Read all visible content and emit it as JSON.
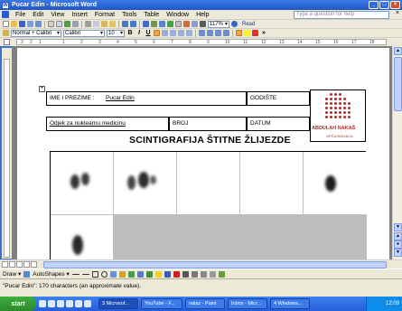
{
  "window": {
    "title": "Pucar Edin - Microsoft Word",
    "min_glyph": "_",
    "max_glyph": "□",
    "close_glyph": "×"
  },
  "menu": {
    "items": [
      "File",
      "Edit",
      "View",
      "Insert",
      "Format",
      "Tools",
      "Table",
      "Window",
      "Help"
    ],
    "help_placeholder": "Type a question for help",
    "close_glyph": "×"
  },
  "toolbar": {
    "zoom": "117%",
    "read_label": "Read",
    "style": "Normal + Calibri",
    "font": "Calibri",
    "font_size": "10",
    "bold": "B",
    "italic": "I",
    "underline": "U"
  },
  "ruler": {
    "ticks": [
      "3",
      "2",
      "1",
      "1",
      "2",
      "3",
      "4",
      "5",
      "6",
      "7",
      "8",
      "9",
      "10",
      "11",
      "12",
      "13",
      "14",
      "15",
      "16",
      "17",
      "18"
    ]
  },
  "document": {
    "name_label": "IME I PREZIME : ",
    "name_value": "Pucar Edin",
    "year_label": "GODIŠTE",
    "department": "Odjek za nuklearnu medicinu",
    "number_label": "BROJ",
    "date_label": "DATUM",
    "heading": "SCINTIGRAFIJA ŠTITNE ŽLIJEZDE",
    "logo_name": "ABDULAH NAKAŠ",
    "logo_sub": "OPĆA BOLNICA"
  },
  "drawing_toolbar": {
    "draw_label": "Draw ▾",
    "autoshapes_label": "AutoShapes ▾"
  },
  "status": {
    "text": "\"Pucar Edin\": 170 characters (an approximate value)."
  },
  "taskbar": {
    "start_label": "start",
    "tasks": [
      "3 Microsof...",
      "YouTube - F...",
      "nalaz - Paint",
      "Inbox - Micr...",
      "4 Windows..."
    ],
    "clock": "12:09"
  },
  "colors": {
    "accent": "#245edb",
    "logo_red": "#b32a2a"
  }
}
